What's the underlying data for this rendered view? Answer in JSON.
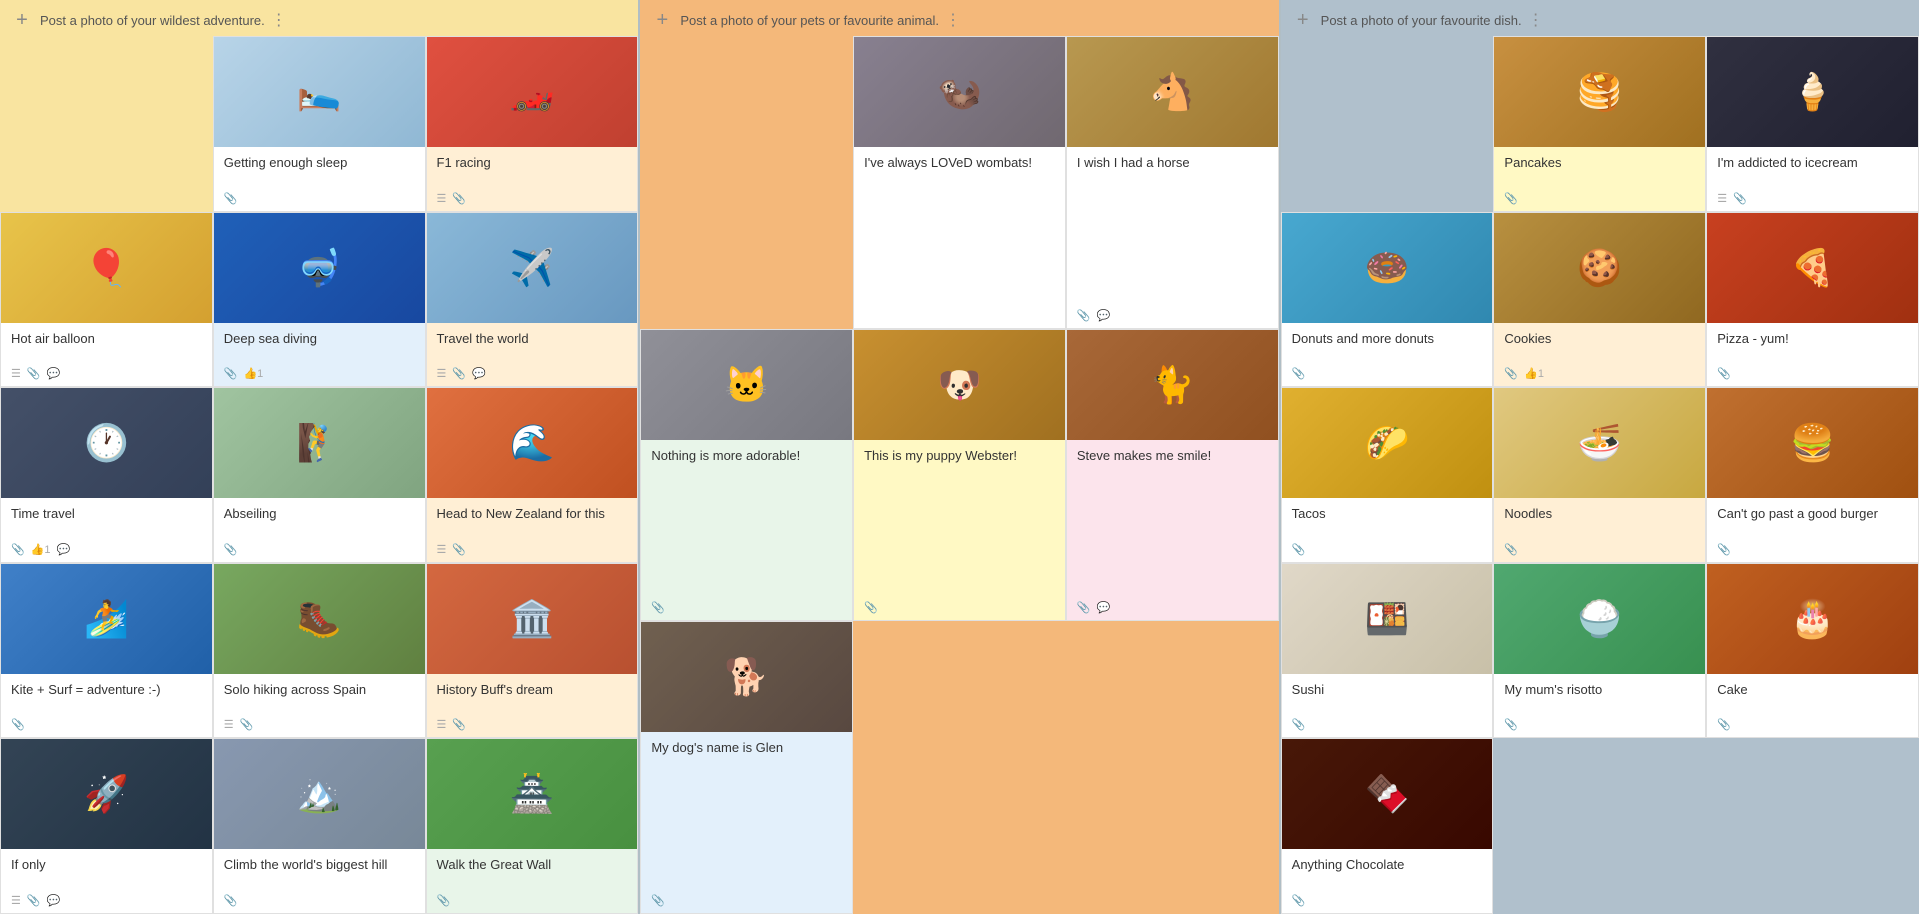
{
  "columns": [
    {
      "id": "col-adventure",
      "bg": "col-yellow",
      "header": "Post a photo of your wildest adventure.",
      "cards": [
        {
          "id": "c1",
          "title": "",
          "img_emoji": "",
          "img_color": "#ccc",
          "meta": [],
          "empty": true
        },
        {
          "id": "c2",
          "title": "Getting enough sleep",
          "img_emoji": "🛌",
          "img_color": "#b8d4e8",
          "meta": [
            "📎"
          ],
          "tint": ""
        },
        {
          "id": "c3",
          "title": "F1 racing",
          "img_emoji": "🏎️",
          "img_color": "#e0554e",
          "meta": [
            "☰",
            "📎"
          ],
          "tint": "tint-peach"
        },
        {
          "id": "c4",
          "title": "Hot air balloon",
          "img_emoji": "🎈",
          "img_color": "#e8c44a",
          "meta": [
            "☰",
            "📎",
            "💬"
          ],
          "tint": ""
        },
        {
          "id": "c5",
          "title": "Deep sea diving",
          "img_emoji": "🤿",
          "img_color": "#2979c9",
          "meta": [
            "📎",
            "👍1"
          ],
          "tint": "tint-blue"
        },
        {
          "id": "c6",
          "title": "Travel the world",
          "img_emoji": "✈️",
          "img_color": "#7cb8e8",
          "meta": [
            "☰",
            "📎",
            "💬"
          ],
          "tint": "tint-peach"
        },
        {
          "id": "c7",
          "title": "Time travel",
          "img_emoji": "🕐",
          "img_color": "#556a8a",
          "meta": [
            "📎",
            "👍1",
            "💬"
          ],
          "tint": ""
        },
        {
          "id": "c8",
          "title": "Abseiling",
          "img_emoji": "🧗",
          "img_color": "#a0c4a0",
          "meta": [
            "📎"
          ],
          "tint": ""
        },
        {
          "id": "c9",
          "title": "Head to New Zealand for this",
          "img_emoji": "🌊",
          "img_color": "#e07040",
          "meta": [
            "☰",
            "📎"
          ],
          "tint": "tint-peach"
        },
        {
          "id": "c10",
          "title": "Kite + Surf = adventure :-)",
          "img_emoji": "🏄",
          "img_color": "#4a90d9",
          "meta": [
            "📎"
          ],
          "tint": ""
        },
        {
          "id": "c11",
          "title": "Solo hiking across Spain",
          "img_emoji": "🥾",
          "img_color": "#88a870",
          "meta": [
            "☰",
            "📎"
          ],
          "tint": ""
        },
        {
          "id": "c12",
          "title": "History Buff's dream",
          "img_emoji": "🏛️",
          "img_color": "#d47050",
          "meta": [
            "☰",
            "📎"
          ],
          "tint": "tint-peach"
        },
        {
          "id": "c13",
          "title": "If only",
          "img_emoji": "🚀",
          "img_color": "#445566",
          "meta": [
            "☰",
            "📎",
            "💬"
          ],
          "tint": ""
        },
        {
          "id": "c14",
          "title": "Climb the world's biggest hill",
          "img_emoji": "🏔️",
          "img_color": "#9ab0c8",
          "meta": [
            "📎"
          ],
          "tint": ""
        },
        {
          "id": "c15",
          "title": "Walk the Great Wall",
          "img_emoji": "🏯",
          "img_color": "#6aaa60",
          "meta": [
            "📎"
          ],
          "tint": "tint-green"
        }
      ]
    },
    {
      "id": "col-pets",
      "bg": "col-orange",
      "header": "Post a photo of your pets or favourite animal.",
      "cards": [
        {
          "id": "p1",
          "title": "",
          "img_emoji": "",
          "img_color": "",
          "meta": [],
          "empty": true
        },
        {
          "id": "p2",
          "title": "I've always LOVeD wombats!",
          "img_emoji": "🦦",
          "img_color": "#8a8080",
          "meta": [],
          "tint": ""
        },
        {
          "id": "p3",
          "title": "I wish I had a horse",
          "img_emoji": "🐴",
          "img_color": "#c0a060",
          "meta": [
            "📎",
            "💬"
          ],
          "tint": ""
        },
        {
          "id": "p4",
          "title": "Nothing is more adorable!",
          "img_emoji": "🐱",
          "img_color": "#a0a0b0",
          "meta": [
            "📎"
          ],
          "tint": "tint-green"
        },
        {
          "id": "p5",
          "title": "This is my puppy Webster!",
          "img_emoji": "🐶",
          "img_color": "#c8943c",
          "meta": [
            "📎"
          ],
          "tint": "tint-yellow"
        },
        {
          "id": "p6",
          "title": "Steve makes me smile!",
          "img_emoji": "🐈",
          "img_color": "#b07850",
          "meta": [
            "📎",
            "💬"
          ],
          "tint": "tint-pink"
        },
        {
          "id": "p7",
          "title": "My dog's name is Glen",
          "img_emoji": "🐕",
          "img_color": "#807060",
          "meta": [
            "📎"
          ],
          "tint": "tint-blue"
        },
        {
          "id": "p8",
          "title": "",
          "img_emoji": "",
          "img_color": "",
          "meta": [],
          "empty": true
        },
        {
          "id": "p9",
          "title": "",
          "img_emoji": "",
          "img_color": "",
          "meta": [],
          "empty": true
        }
      ]
    },
    {
      "id": "col-food",
      "bg": "col-blue",
      "header": "Post a photo of your favourite dish.",
      "cards": [
        {
          "id": "f1",
          "title": "",
          "img_emoji": "",
          "img_color": "",
          "meta": [],
          "empty": true
        },
        {
          "id": "f2",
          "title": "Pancakes",
          "img_emoji": "🥞",
          "img_color": "#d4a050",
          "meta": [
            "📎"
          ],
          "tint": "tint-yellow"
        },
        {
          "id": "f3",
          "title": "I'm addicted to icecream",
          "img_emoji": "🍦",
          "img_color": "#3a3a4a",
          "meta": [
            "☰",
            "📎"
          ],
          "tint": ""
        },
        {
          "id": "f4",
          "title": "Donuts and more donuts",
          "img_emoji": "🍩",
          "img_color": "#5ab0d8",
          "meta": [
            "📎"
          ],
          "tint": ""
        },
        {
          "id": "f5",
          "title": "Cookies",
          "img_emoji": "🍪",
          "img_color": "#c0a060",
          "meta": [
            "📎",
            "👍1"
          ],
          "tint": "tint-peach"
        },
        {
          "id": "f6",
          "title": "Pizza - yum!",
          "img_emoji": "🍕",
          "img_color": "#d05030",
          "meta": [
            "📎"
          ],
          "tint": ""
        },
        {
          "id": "f7",
          "title": "Tacos",
          "img_emoji": "🌮",
          "img_color": "#e8b840",
          "meta": [
            "📎"
          ],
          "tint": ""
        },
        {
          "id": "f8",
          "title": "Noodles",
          "img_emoji": "🍜",
          "img_color": "#e8d0a0",
          "meta": [
            "📎"
          ],
          "tint": "tint-peach"
        },
        {
          "id": "f9",
          "title": "Can't go past a good burger",
          "img_emoji": "🍔",
          "img_color": "#c87840",
          "meta": [
            "📎"
          ],
          "tint": ""
        },
        {
          "id": "f10",
          "title": "Sushi",
          "img_emoji": "🍱",
          "img_color": "#e8e0d8",
          "meta": [
            "📎"
          ],
          "tint": ""
        },
        {
          "id": "f11",
          "title": "My mum's risotto",
          "img_emoji": "🍚",
          "img_color": "#60a880",
          "meta": [
            "📎"
          ],
          "tint": ""
        },
        {
          "id": "f12",
          "title": "Cake",
          "img_emoji": "🎂",
          "img_color": "#d06828",
          "meta": [
            "📎"
          ],
          "tint": ""
        },
        {
          "id": "f13",
          "title": "Anything Chocolate",
          "img_emoji": "🍫",
          "img_color": "#5a3018",
          "meta": [
            "📎"
          ],
          "tint": ""
        },
        {
          "id": "f14",
          "title": "",
          "img_emoji": "",
          "img_color": "",
          "meta": [],
          "empty": true
        },
        {
          "id": "f15",
          "title": "",
          "img_emoji": "",
          "img_color": "",
          "meta": [],
          "empty": true
        }
      ]
    }
  ],
  "add_label": "+",
  "dots_label": "⋮",
  "settings_icon": "⊞"
}
